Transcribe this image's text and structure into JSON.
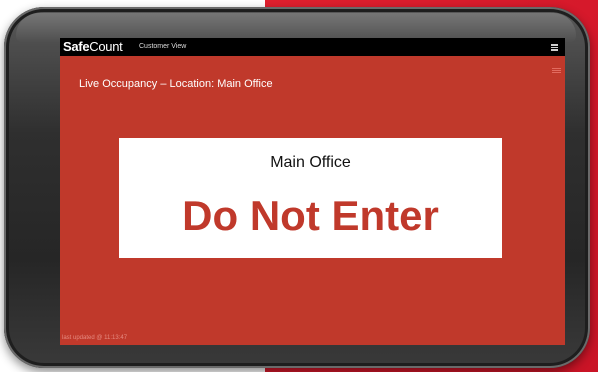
{
  "app": {
    "brand_safe": "Safe",
    "brand_count": "Count",
    "view_label": "Customer View",
    "menu_icon": "menu-icon"
  },
  "screen": {
    "location_line": "Live Occupancy – Location: Main Office",
    "sign": {
      "location": "Main Office",
      "status": "Do Not Enter"
    },
    "updated_text": "last updated @ 11:13:47"
  },
  "colors": {
    "screen_background": "#c0392b",
    "status_text": "#c0392b",
    "topbar": "#000000",
    "backdrop_accent": "#e0202e",
    "sign_card": "#ffffff"
  }
}
